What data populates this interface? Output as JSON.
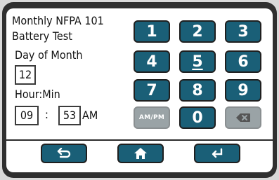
{
  "title": {
    "line1": "Monthly NFPA 101",
    "line2": "Battery Test"
  },
  "day": {
    "label": "Day of Month",
    "value": "12"
  },
  "time": {
    "label": "Hour:Min",
    "hour": "09",
    "separator": ":",
    "minute": "53",
    "ampm": "AM"
  },
  "keypad": {
    "k1": "1",
    "k2": "2",
    "k3": "3",
    "k4": "4",
    "k5": "5",
    "k6": "6",
    "k7": "7",
    "k8": "8",
    "k9": "9",
    "ampm": "AM/PM",
    "k0": "0"
  },
  "icons": {
    "backspace": "backspace-icon",
    "back": "back-arrow-icon",
    "home": "home-icon",
    "enter": "enter-icon"
  },
  "colors": {
    "key": "#1a5f77",
    "key_disabled": "#9aa3a6",
    "bezel": "#2f2f2f"
  }
}
